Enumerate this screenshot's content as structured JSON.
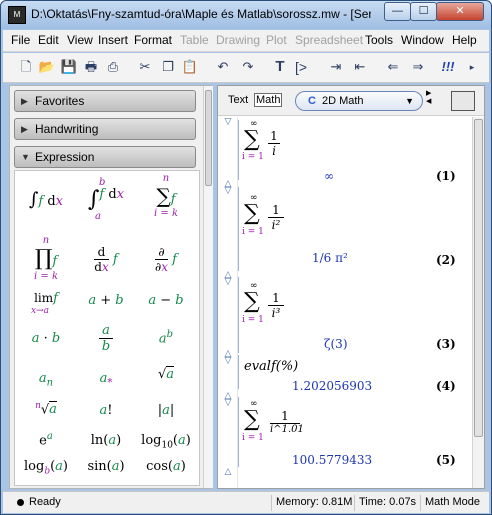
{
  "window": {
    "title": "D:\\Oktatás\\Fny-szamtud-óra\\Maple és Matlab\\sorossz.mw - [Ser...",
    "app_icon": "maple-leaf-icon",
    "min_label": "—",
    "max_label": "☐",
    "close_label": "✕"
  },
  "menubar": {
    "items": [
      "File",
      "Edit",
      "View",
      "Insert",
      "Format",
      "Table",
      "Drawing",
      "Plot",
      "Spreadsheet",
      "Tools",
      "Window",
      "Help"
    ]
  },
  "toolbar": {
    "icons": [
      "new-document-icon",
      "open-folder-icon",
      "save-icon",
      "print-icon",
      "print-preview-icon",
      "cut-icon",
      "copy-icon",
      "paste-icon",
      "undo-icon",
      "redo-icon",
      "text-mode-icon",
      "math-mode-icon",
      "indent-icon",
      "outdent-icon",
      "back-icon",
      "forward-icon",
      "execute-all-icon"
    ]
  },
  "palettes": {
    "favorites": "Favorites",
    "handwriting": "Handwriting",
    "expression": "Expression"
  },
  "expression_cells": [
    {
      "a": "∫",
      "b": "f",
      "c": " dx"
    },
    {
      "a": "∫",
      "b": "f",
      "c": " dx",
      "top": "b",
      "bot": "a"
    },
    {
      "a": "∑",
      "b": "f",
      "top": "n",
      "bot": "i = k"
    },
    {
      "a": "∏",
      "b": "f",
      "top": "n",
      "bot": "i = k"
    },
    {
      "a": "d/dx",
      "b": "f"
    },
    {
      "a": "∂/∂x",
      "b": "f"
    },
    {
      "a": "lim",
      "b": "f",
      "bot": "x→a"
    },
    {
      "a": "a + b"
    },
    {
      "a": "a − b"
    },
    {
      "a": "a · b"
    },
    {
      "a": "a / b"
    },
    {
      "a": "a^b"
    },
    {
      "a": "a_n"
    },
    {
      "a": "a*"
    },
    {
      "a": "√a"
    },
    {
      "a": "ⁿ√a"
    },
    {
      "a": "a!"
    },
    {
      "a": "|a|"
    },
    {
      "a": "e^a"
    },
    {
      "a": "ln(a)"
    },
    {
      "a": "log10(a)"
    },
    {
      "a": "log_b(a)"
    },
    {
      "a": "sin(a)"
    },
    {
      "a": "cos(a)"
    }
  ],
  "context_bar": {
    "text_tab": "Text",
    "math_tab": "Math",
    "mode_icon": "C",
    "mode_label": "2D Math"
  },
  "document": {
    "groups": [
      {
        "sum_top": "∞",
        "sum_bot": "i = 1",
        "num": "1",
        "den": "i",
        "result": "∞",
        "label": "(1)"
      },
      {
        "sum_top": "∞",
        "sum_bot": "i = 1",
        "num": "1",
        "den": "i²",
        "result": "1/6 π²",
        "label": "(2)"
      },
      {
        "sum_top": "∞",
        "sum_bot": "i = 1",
        "num": "1",
        "den": "i³",
        "result": "ζ(3)",
        "label": "(3)"
      },
      {
        "command": "evalf(%)",
        "result": "1.202056903",
        "label": "(4)"
      },
      {
        "sum_top": "∞",
        "sum_bot": "i = 1",
        "num": "1",
        "den": "i^1.01",
        "result": "100.5779433",
        "label": "(5)"
      }
    ]
  },
  "statusbar": {
    "ready": "Ready",
    "memory": "Memory: 0.81M",
    "time": "Time: 0.07s",
    "mode": "Math Mode"
  }
}
